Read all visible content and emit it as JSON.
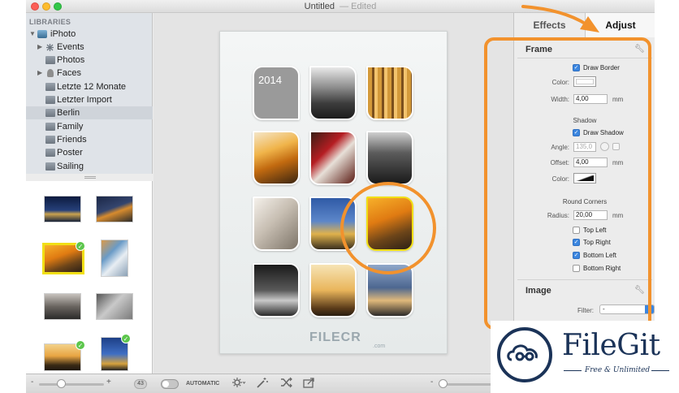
{
  "window": {
    "title": "Untitled",
    "status": "— Edited"
  },
  "sidebar": {
    "header": "LIBRARIES",
    "items": [
      {
        "label": "iPhoto",
        "icon": "iphoto-library-icon"
      },
      {
        "label": "Events",
        "icon": "events-icon"
      },
      {
        "label": "Photos",
        "icon": "album-icon"
      },
      {
        "label": "Faces",
        "icon": "faces-icon"
      },
      {
        "label": "Letzte 12 Monate",
        "icon": "album-icon"
      },
      {
        "label": "Letzter Import",
        "icon": "album-icon"
      },
      {
        "label": "Berlin",
        "icon": "album-icon"
      },
      {
        "label": "Family",
        "icon": "album-icon"
      },
      {
        "label": "Friends",
        "icon": "album-icon"
      },
      {
        "label": "Poster",
        "icon": "album-icon"
      },
      {
        "label": "Sailing",
        "icon": "album-icon"
      }
    ],
    "selected": "Berlin"
  },
  "canvas": {
    "year_tile": "2014",
    "watermark": "FILECR",
    "watermark_sub": ".com"
  },
  "inspector": {
    "tabs": {
      "effects": "Effects",
      "adjust": "Adjust"
    },
    "frame": {
      "title": "Frame",
      "draw_border": "Draw Border",
      "color_label": "Color:",
      "width_label": "Width:",
      "width_value": "4,00",
      "unit": "mm",
      "shadow_head": "Shadow",
      "draw_shadow": "Draw Shadow",
      "angle_label": "Angle:",
      "angle_value": "135,0",
      "offset_label": "Offset:",
      "offset_value": "4,00",
      "shadow_color_label": "Color:",
      "round_head": "Round Corners",
      "radius_label": "Radius:",
      "radius_value": "20,00",
      "corners": [
        {
          "label": "Top Left",
          "checked": false
        },
        {
          "label": "Top Right",
          "checked": true
        },
        {
          "label": "Bottom Left",
          "checked": true
        },
        {
          "label": "Bottom Right",
          "checked": false
        }
      ]
    },
    "image": {
      "title": "Image",
      "filter_label": "Filter:",
      "filter_value": "-"
    }
  },
  "toolbar": {
    "minus": "-",
    "plus": "+",
    "count": "43",
    "automatic": "AUTOMATIC"
  },
  "badge": {
    "name": "FileGit",
    "tagline": "Free & Unlimited"
  },
  "colors": {
    "accent_orange": "#f2922d",
    "selection_yellow": "#f1df16",
    "checkbox_blue": "#3b86e0",
    "brand_navy": "#1b3358"
  }
}
